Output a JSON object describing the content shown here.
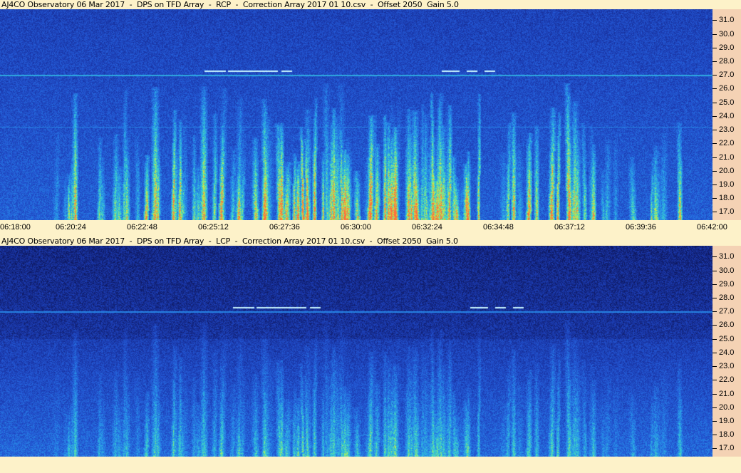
{
  "panels": [
    {
      "title": "AJ4CO Observatory 06 Mar 2017  -  DPS on TFD Array  -  RCP  -  Correction Array 2017 01 10.csv  -  Offset 2050  Gain 5.0",
      "polarization": "RCP"
    },
    {
      "title": "AJ4CO Observatory 06 Mar 2017  -  DPS on TFD Array  -  LCP  -  Correction Array 2017 01 10.csv  -  Offset 2050  Gain 5.0",
      "polarization": "LCP"
    }
  ],
  "time_labels": [
    "06:18:00",
    "06:20:24",
    "06:22:48",
    "06:25:12",
    "06:27:36",
    "06:30:00",
    "06:32:24",
    "06:34:48",
    "06:37:12",
    "06:39:36",
    "06:42:00"
  ],
  "freq_labels": [
    "31.0",
    "30.0",
    "29.0",
    "28.0",
    "27.0",
    "26.0",
    "25.0",
    "24.0",
    "23.0",
    "22.0",
    "21.0",
    "20.0",
    "19.0",
    "18.0",
    "17.0"
  ],
  "chart_data": [
    {
      "type": "heatmap",
      "title": "AJ4CO Observatory 06 Mar 2017  -  DPS on TFD Array  -  RCP  -  Correction Array 2017 01 10.csv  -  Offset 2050  Gain 5.0",
      "x_range": [
        "06:18:00",
        "06:42:00"
      ],
      "y_range_mhz": [
        16.4,
        31.8
      ],
      "x_ticks": [
        "06:18:00",
        "06:20:24",
        "06:22:48",
        "06:25:12",
        "06:27:36",
        "06:30:00",
        "06:32:24",
        "06:34:48",
        "06:37:12",
        "06:39:36",
        "06:42:00"
      ],
      "y_ticks": [
        31.0,
        30.0,
        29.0,
        28.0,
        27.0,
        26.0,
        25.0,
        24.0,
        23.0,
        22.0,
        21.0,
        20.0,
        19.0,
        18.0,
        17.0
      ],
      "colormap": [
        "#10206f",
        "#1a3fb0",
        "#2a70e0",
        "#30b8e8",
        "#50e0b0",
        "#d8f040",
        "#ff6040"
      ],
      "grid": false
    },
    {
      "type": "heatmap",
      "title": "AJ4CO Observatory 06 Mar 2017  -  DPS on TFD Array  -  LCP  -  Correction Array 2017 01 10.csv  -  Offset 2050  Gain 5.0",
      "x_range": [
        "06:18:00",
        "06:42:00"
      ],
      "y_range_mhz": [
        16.4,
        31.8
      ],
      "y_ticks": [
        31.0,
        30.0,
        29.0,
        28.0,
        27.0,
        26.0,
        25.0,
        24.0,
        23.0,
        22.0,
        21.0,
        20.0,
        19.0,
        18.0,
        17.0
      ],
      "colormap": [
        "#0c1a5a",
        "#1a3fb0",
        "#2a70e0",
        "#30b8e8"
      ],
      "grid": false
    }
  ]
}
